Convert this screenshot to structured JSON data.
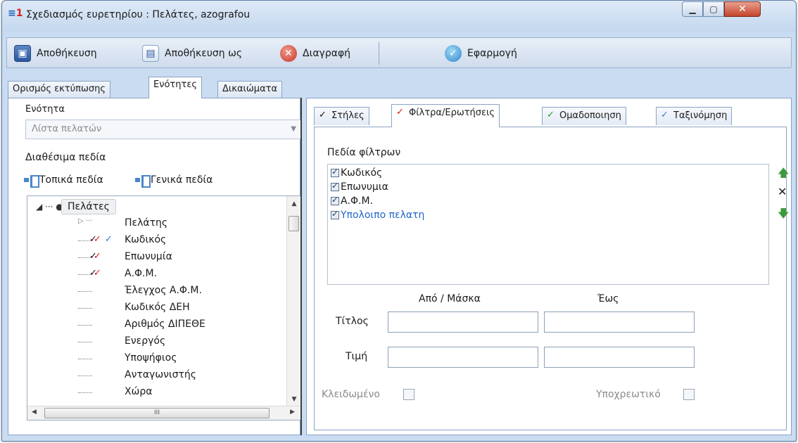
{
  "window": {
    "logo_text": "S1",
    "title": "Σχεδιασμός ευρετηρίου : Πελάτες, azografou",
    "minimize": "▁",
    "maximize": "▢",
    "close": "✕"
  },
  "toolbar": {
    "save_label": "Αποθήκευση",
    "save_as_label": "Αποθήκευση ως",
    "delete_label": "Διαγραφή",
    "apply_label": "Εφαρμογή",
    "icons": [
      "floppy-disk-icon",
      "save-as-icon",
      "delete-icon",
      "apply-icon"
    ]
  },
  "main_tabs": [
    {
      "label": "Ορισμός εκτύπωσης"
    },
    {
      "label": "Ενότητες",
      "active": true
    },
    {
      "label": "Δικαιώματα"
    }
  ],
  "left": {
    "section_label": "Ενότητα",
    "section_value": "Λίστα πελατών",
    "available_fields_label": "Διαθέσιμα πεδία",
    "local_fields_label": "Τοπικά πεδία",
    "general_fields_label": "Γενικά πεδία",
    "tree_root": "Πελάτες",
    "tree_root_marks": "◢ ··· ●",
    "tree_items": [
      {
        "label": "Πελάτης",
        "marks": "▷ ···"
      },
      {
        "label": "Κωδικός",
        "marks": "✓✓✓"
      },
      {
        "label": "Επωνυμία",
        "marks": "✓✓"
      },
      {
        "label": "Α.Φ.Μ.",
        "marks": "✓✓"
      },
      {
        "label": "Έλεγχος Α.Φ.Μ.",
        "marks": ""
      },
      {
        "label": "Κωδικός ΔΕΗ",
        "marks": ""
      },
      {
        "label": "Αριθμός ΔΙΠΕΘΕ",
        "marks": ""
      },
      {
        "label": "Ενεργός",
        "marks": ""
      },
      {
        "label": "Υποψήφιος",
        "marks": ""
      },
      {
        "label": "Ανταγωνιστής",
        "marks": ""
      },
      {
        "label": "Χώρα",
        "marks": ""
      }
    ],
    "hscroll_grip": "III"
  },
  "right": {
    "subtabs": [
      {
        "label": "Στήλες",
        "check": "✓",
        "check_color": "#111111"
      },
      {
        "label": "Φίλτρα/Ερωτήσεις",
        "check": "✓",
        "check_color": "#e01919",
        "active": true
      },
      {
        "label": "Ομαδοποιηση",
        "check": "✓",
        "check_color": "#1ea51e"
      },
      {
        "label": "Ταξινόμηση",
        "check": "✓",
        "check_color": "#2a7ad8"
      }
    ],
    "filter_fields_label": "Πεδία φίλτρων",
    "filter_fields": [
      {
        "label": "Κωδικός",
        "checked": true
      },
      {
        "label": "Επωνυμια",
        "checked": true
      },
      {
        "label": "Α.Φ.Μ.",
        "checked": true
      },
      {
        "label": "Υπολοιπο πελατη",
        "checked": true,
        "highlight": true
      }
    ],
    "move_up": "🡅",
    "remove": "✕",
    "move_down": "🡇",
    "from_mask_label": "Από / Μάσκα",
    "to_label": "Έως",
    "title_label": "Τίτλος",
    "value_label": "Τιμή",
    "title_from": "",
    "title_to": "",
    "value_from": "",
    "value_to": "",
    "locked_label": "Κλειδωμένο",
    "required_label": "Υποχρεωτικό"
  }
}
